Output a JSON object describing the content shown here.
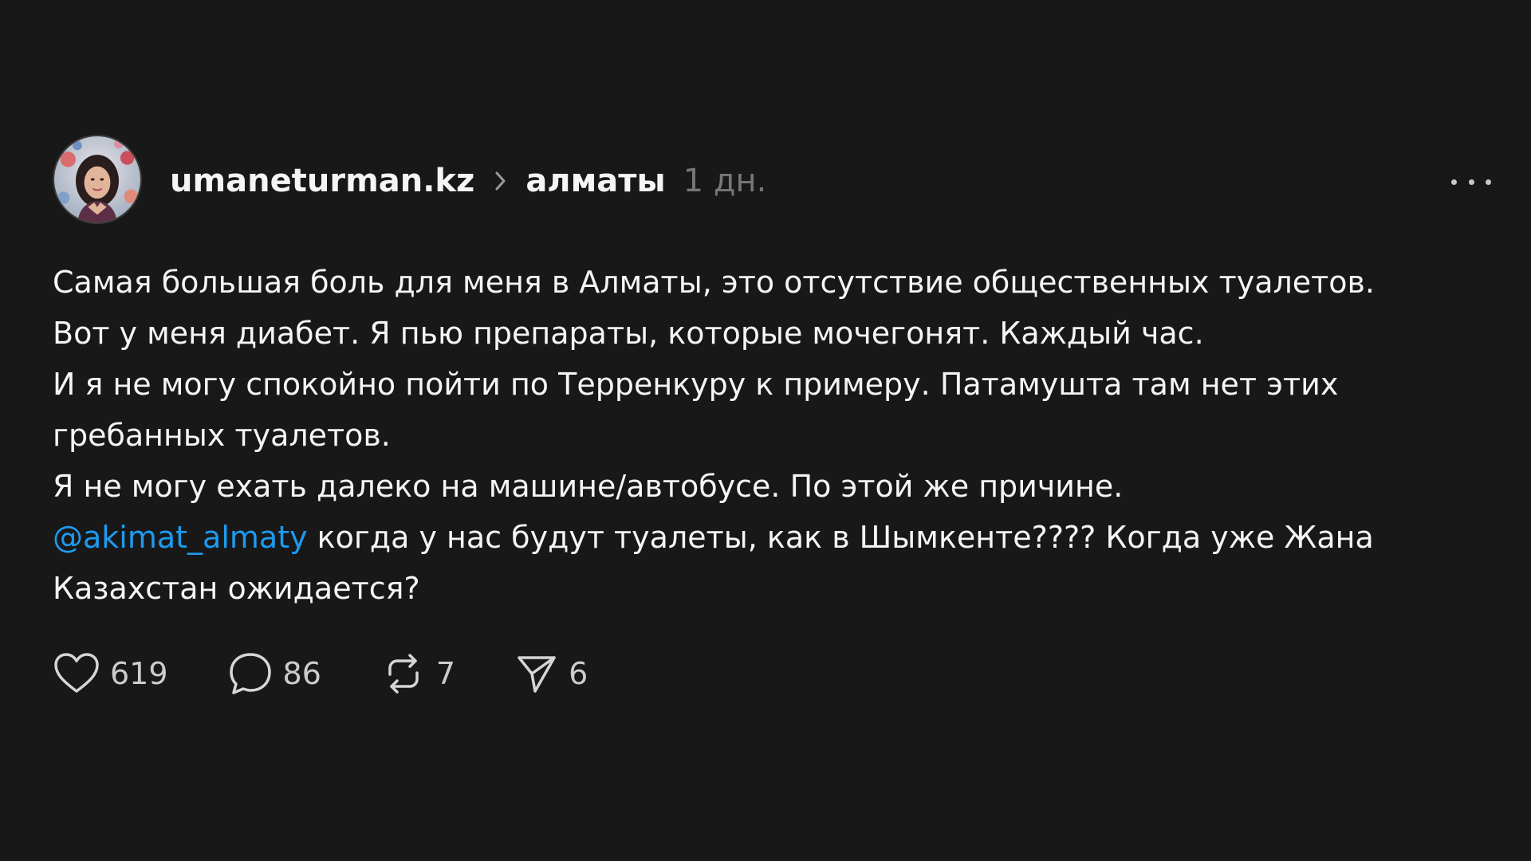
{
  "post": {
    "username": "umaneturman.kz",
    "topic": "алматы",
    "time": "1 дн.",
    "lines": [
      "Самая большая боль для меня в Алматы, это отсутствие общественных туалетов.",
      "Вот у меня диабет. Я пью препараты, которые мочегонят. Каждый час.",
      "И я не могу спокойно пойти по Терренкуру к примеру. Патамушта там нет этих",
      "гребанных туалетов.",
      "Я не могу ехать далеко на машине/автобусе. По этой же причине."
    ],
    "mention": "@akimat_almaty",
    "mention_rest": " когда у нас будут туалеты, как в Шымкенте???? Когда уже Жана",
    "last_line": "Казахстан ожидается?"
  },
  "actions": {
    "likes": "619",
    "comments": "86",
    "reposts": "7",
    "shares": "6"
  },
  "colors": {
    "background": "#181818",
    "text": "#f3f5f7",
    "muted": "#777777",
    "mention": "#1d9bf0"
  },
  "icons": {
    "avatar": "user-avatar",
    "chevron": "chevron-right-icon",
    "more": "more-horizontal-icon",
    "like": "heart-icon",
    "comment": "comment-icon",
    "repost": "repost-icon",
    "share": "send-icon"
  }
}
